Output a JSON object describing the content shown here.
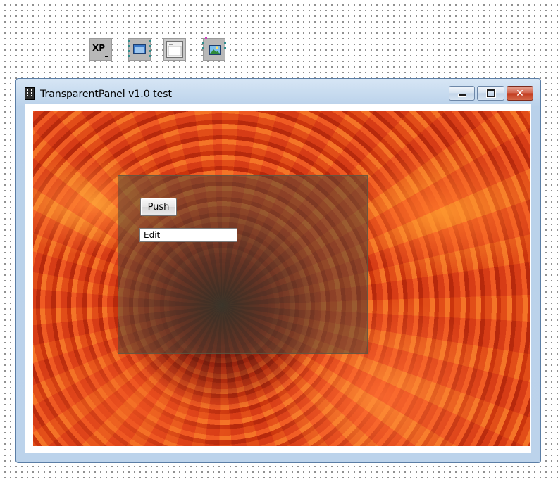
{
  "palette": {
    "components": [
      {
        "name": "xp-manifest-component",
        "label": "XP"
      },
      {
        "name": "panel-component",
        "label": ""
      },
      {
        "name": "form-component",
        "label": ""
      },
      {
        "name": "image-component",
        "label": ""
      }
    ]
  },
  "window": {
    "title": "TransparentPanel v1.0 test",
    "icon": "film-strip-icon",
    "caption_buttons": {
      "minimize": "minimize-icon",
      "maximize": "maximize-icon",
      "close": "✕"
    }
  },
  "panel": {
    "push_label": "Push",
    "edit_value": "Edit"
  },
  "colors": {
    "panel_tint": "#50463780",
    "close_red": "#c1381b",
    "flower_orange": "#e0501e"
  }
}
